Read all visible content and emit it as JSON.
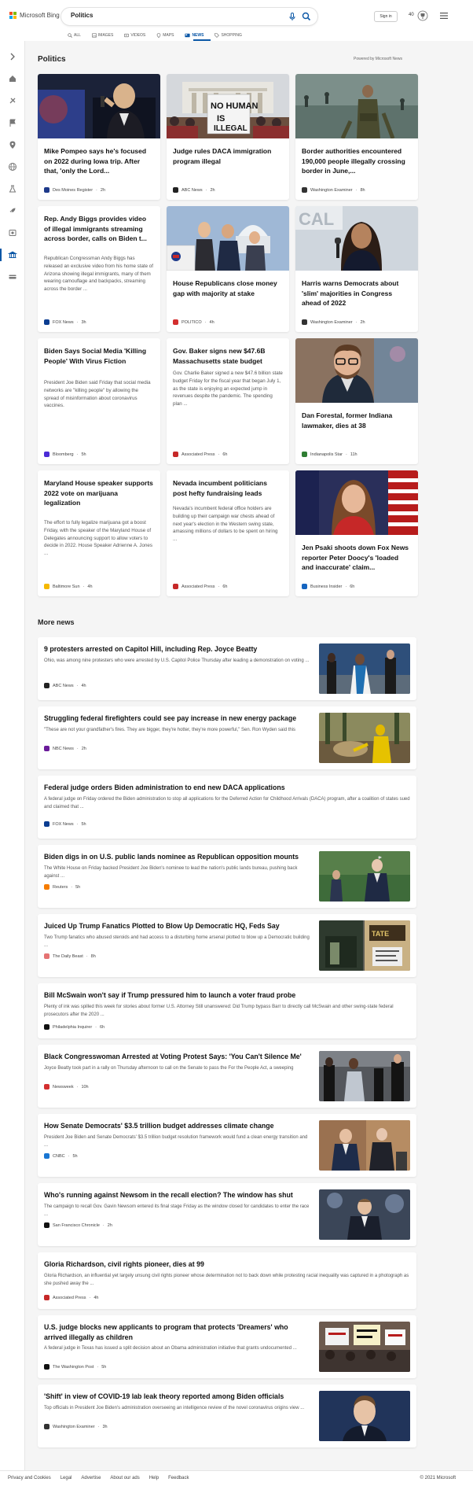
{
  "brand": {
    "name": "Microsoft Bing",
    "logo_colors": [
      "#f25022",
      "#7fba00",
      "#00a4ef",
      "#ffb900"
    ],
    "accent": "#0b57a6"
  },
  "search": {
    "value": "Politics"
  },
  "account": {
    "signin_label": "Sign in",
    "points": "40"
  },
  "tabs": [
    {
      "label": "ALL",
      "icon": "search-icon"
    },
    {
      "label": "IMAGES",
      "icon": "image-icon"
    },
    {
      "label": "VIDEOS",
      "icon": "video-icon"
    },
    {
      "label": "MAPS",
      "icon": "map-pin-icon"
    },
    {
      "label": "NEWS",
      "icon": "news-icon",
      "active": true
    },
    {
      "label": "SHOPPING",
      "icon": "tag-icon"
    }
  ],
  "sidebar_icons": [
    "chevron-right-icon",
    "home-icon",
    "sports-icon",
    "flag-icon",
    "location-icon",
    "globe-icon",
    "science-icon",
    "rocket-icon",
    "entertainment-icon",
    "politics-icon",
    "money-icon"
  ],
  "section": {
    "title": "Politics",
    "powered_by": "Powered by Microsoft News"
  },
  "cards": [
    {
      "title": "Mike Pompeo says he's focused on 2022 during Iowa trip. After that, 'only the Lord...",
      "desc": "",
      "source": "Des Moines Register",
      "time": "2h",
      "src_color": "#1e3a8a",
      "has_image": true,
      "img": "pompeo"
    },
    {
      "title": "Judge rules DACA immigration program illegal",
      "desc": "",
      "source": "ABC News",
      "time": "2h",
      "src_color": "#222222",
      "has_image": true,
      "img": "daca"
    },
    {
      "title": "Border authorities encountered 190,000 people illegally crossing border in June,...",
      "desc": "",
      "source": "Washington Examiner",
      "time": "8h",
      "src_color": "#333333",
      "has_image": true,
      "img": "border"
    },
    {
      "title": "Rep. Andy Biggs provides video of illegal immigrants streaming across border, calls on Biden t...",
      "desc": "Republican Congressman Andy Biggs has released an exclusive video from his home state of Arizona showing illegal immigrants, many of them wearing camouflage and backpacks, streaming across the border ...",
      "source": "FOX News",
      "time": "3h",
      "src_color": "#0b3d91",
      "has_image": false
    },
    {
      "title": "House Republicans close money gap with majority at stake",
      "desc": "",
      "source": "POLITICO",
      "time": "4h",
      "src_color": "#d32f2f",
      "has_image": true,
      "img": "house"
    },
    {
      "title": "Harris warns Democrats about 'slim' majorities in Congress ahead of 2022",
      "desc": "",
      "source": "Washington Examiner",
      "time": "2h",
      "src_color": "#333333",
      "has_image": true,
      "img": "harris"
    },
    {
      "title": "Biden Says Social Media 'Killing People' With Virus Fiction",
      "desc": "President Joe Biden said Friday that social media networks are \"killing people\" by allowing the spread of misinformation about coronavirus vaccines.",
      "source": "Bloomberg",
      "time": "5h",
      "src_color": "#4b2bd6",
      "has_image": false
    },
    {
      "title": "Gov. Baker signs new $47.6B Massachusetts state budget",
      "desc": "Gov. Charlie Baker signed a new $47.6 billion state budget Friday for the fiscal year that began July 1, as the state is enjoying an expected jump in revenues despite the pandemic. The spending plan ...",
      "source": "Associated Press",
      "time": "6h",
      "src_color": "#c62828",
      "has_image": false
    },
    {
      "title": "Dan Forestal, former Indiana lawmaker, dies at 38",
      "desc": "",
      "source": "Indianapolis Star",
      "time": "11h",
      "src_color": "#2e7d32",
      "has_image": true,
      "img": "forestal"
    },
    {
      "title": "Maryland House speaker supports 2022 vote on marijuana legalization",
      "desc": "The effort to fully legalize marijuana got a boost Friday, with the speaker of the Maryland House of Delegates announcing support to allow voters to decide in 2022. House Speaker Adrienne A. Jones ...",
      "source": "Baltimore Sun",
      "time": "4h",
      "src_color": "#f5b800",
      "has_image": false
    },
    {
      "title": "Nevada incumbent politicians post hefty fundraising leads",
      "desc": "Nevada's incumbent federal office holders are building up their campaign war chests ahead of next year's election in the Western swing state, amassing millions of dollars to be spent on hiring ...",
      "source": "Associated Press",
      "time": "6h",
      "src_color": "#c62828",
      "has_image": false
    },
    {
      "title": "Jen Psaki shoots down Fox News reporter Peter Doocy's 'loaded and inaccurate' claim...",
      "desc": "",
      "source": "Business Insider",
      "time": "6h",
      "src_color": "#1565c0",
      "has_image": true,
      "img": "psaki"
    }
  ],
  "more_news": {
    "title": "More news",
    "items": [
      {
        "title": "9 protesters arrested on Capitol Hill, including Rep. Joyce Beatty",
        "desc": "Ohio, was among nine protesters who were arrested by U.S. Capitol Police Thursday after leading a demonstration on voting ...",
        "source": "ABC News",
        "time": "4h",
        "src_color": "#222222",
        "thumb": "protest"
      },
      {
        "title": "Struggling federal firefighters could see pay increase in new energy package",
        "desc": "\"These are not your grandfather's fires. They are bigger, they're hotter, they're more powerful,\" Sen. Ron Wyden said this",
        "source": "NBC News",
        "time": "2h",
        "src_color": "#6a1b9a",
        "thumb": "fire"
      },
      {
        "title": "Federal judge orders Biden administration to end new DACA applications",
        "desc": "A federal judge on Friday ordered the Biden administration to stop all applications for the Deferred Action for Childhood Arrivals (DACA) program, after a coalition of states sued and claimed that ...",
        "source": "FOX News",
        "time": "5h",
        "src_color": "#0b3d91",
        "thumb": ""
      },
      {
        "title": "Biden digs in on U.S. public lands nominee as Republican opposition mounts",
        "desc": "The White House on Friday backed President Joe Biden's nominee to lead the nation's public lands bureau, pushing back against ...",
        "source": "Reuters",
        "time": "5h",
        "src_color": "#f57c00",
        "thumb": "biden"
      },
      {
        "title": "Juiced Up Trump Fanatics Plotted to Blow Up Democratic HQ, Feds Say",
        "desc": "Two Trump fanatics who abused steroids and had access to a disturbing home arsenal plotted to blow up a Democratic building ...",
        "source": "The Daily Beast",
        "time": "8h",
        "src_color": "#e57373",
        "thumb": "hq"
      },
      {
        "title": "Bill McSwain won't say if Trump pressured him to launch a voter fraud probe",
        "desc": "Plenty of ink was spilled this week for stories about former U.S. Attorney Still unanswered: Did Trump bypass Barr to directly call McSwain and other swing-state federal prosecutors after the 2020 ...",
        "source": "Philadelphia Inquirer",
        "time": "6h",
        "src_color": "#111111",
        "thumb": ""
      },
      {
        "title": "Black Congresswoman Arrested at Voting Protest Says: 'You Can't Silence Me'",
        "desc": "Joyce Beatty took part in a rally on Thursday afternoon to call on the Senate to pass the For the People Act, a sweeping",
        "source": "Newsweek",
        "time": "10h",
        "src_color": "#d32f2f",
        "thumb": "arrest"
      },
      {
        "title": "How Senate Democrats' $3.5 trillion budget addresses climate change",
        "desc": "President Joe Biden and Senate Democrats' $3.5 trillion budget resolution framework would fund a clean energy transition and ...",
        "source": "CNBC",
        "time": "5h",
        "src_color": "#1976d2",
        "thumb": "senate"
      },
      {
        "title": "Who's running against Newsom in the recall election? The window has shut",
        "desc": "The campaign to recall Gov. Gavin Newsom entered its final stage Friday as the window closed for candidates to enter the race ...",
        "source": "San Francisco Chronicle",
        "time": "2h",
        "src_color": "#111111",
        "thumb": "newsom"
      },
      {
        "title": "Gloria Richardson, civil rights pioneer, dies at 99",
        "desc": "Gloria Richardson, an influential yet largely unsung civil rights pioneer whose determination not to back down while protesting racial inequality was captured in a photograph as she pushed away the ...",
        "source": "Associated Press",
        "time": "4h",
        "src_color": "#c62828",
        "thumb": ""
      },
      {
        "title": "U.S. judge blocks new applicants to program that protects 'Dreamers' who arrived illegally as children",
        "desc": "A federal judge in Texas has issued a split decision about an Obama administration initiative that grants undocumented ...",
        "source": "The Washington Post",
        "time": "5h",
        "src_color": "#111111",
        "thumb": "dreamers"
      },
      {
        "title": "'Shift' in view of COVID-19 lab leak theory reported among Biden officials",
        "desc": "Top officials in President Joe Biden's administration overseeing an intelligence review of the novel coronavirus origins view ...",
        "source": "Washington Examiner",
        "time": "3h",
        "src_color": "#333333",
        "thumb": "sullivan"
      }
    ]
  },
  "footer": {
    "links": [
      "Privacy and Cookies",
      "Legal",
      "Advertise",
      "About our ads",
      "Help",
      "Feedback"
    ],
    "copyright": "© 2021 Microsoft"
  }
}
